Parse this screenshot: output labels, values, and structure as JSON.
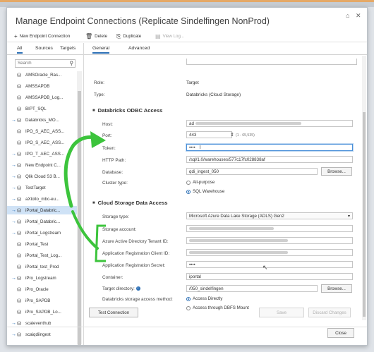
{
  "window": {
    "title": "Manage Endpoint Connections (Replicate Sindelfingen NonProd)",
    "restore_glyph": "⌂",
    "close_glyph": "✕"
  },
  "toolbar": {
    "new_label": "New Endpoint Connection",
    "delete_label": "Delete",
    "duplicate_label": "Duplicate",
    "view_logs_label": "View Log..."
  },
  "left": {
    "tabs": [
      "All",
      "Sources",
      "Targets"
    ],
    "search_placeholder": "Search",
    "items": [
      {
        "label": "AMSOracle_Ras...",
        "arrow": ""
      },
      {
        "label": "AMSSAPDB",
        "arrow": ""
      },
      {
        "label": "AMSSAPDB_Log...",
        "arrow": ""
      },
      {
        "label": "BIPT_SQL",
        "arrow": ""
      },
      {
        "label": "Databricks_MO...",
        "arrow": "→"
      },
      {
        "label": "IPO_S_AEC_ASS...",
        "arrow": ""
      },
      {
        "label": "IPO_S_AEC_ASS...",
        "arrow": ""
      },
      {
        "label": "IPO_T_AEC_ASS...",
        "arrow": "→"
      },
      {
        "label": "New Endpoint C...",
        "arrow": "→"
      },
      {
        "label": "Qlik Cloud S3 B...",
        "arrow": "→"
      },
      {
        "label": "TestTarget",
        "arrow": "→"
      },
      {
        "label": "aXtollo_mbc-eu...",
        "arrow": "→"
      },
      {
        "label": "iPortal_Databric...",
        "arrow": "→"
      },
      {
        "label": "iPortal_Databric...",
        "arrow": "→"
      },
      {
        "label": "iPortal_Logstream",
        "arrow": "→"
      },
      {
        "label": "iPortal_Test",
        "arrow": ""
      },
      {
        "label": "iPortal_Test_Log...",
        "arrow": ""
      },
      {
        "label": "iPortal_test_Prod",
        "arrow": ""
      },
      {
        "label": "iPro_Logstream",
        "arrow": "→"
      },
      {
        "label": "iPro_Oracle",
        "arrow": ""
      },
      {
        "label": "iPro_SAPDB",
        "arrow": ""
      },
      {
        "label": "iPro_SAPDB_Lo...",
        "arrow": ""
      },
      {
        "label": "scaieventhub",
        "arrow": "→"
      },
      {
        "label": "scaiqdiingest",
        "arrow": "→"
      }
    ],
    "selected_index": 12
  },
  "right": {
    "tabs": [
      "General",
      "Advanced"
    ],
    "role_label": "Role:",
    "role_value": "Target",
    "type_label": "Type:",
    "type_value": "Databricks (Cloud Storage)",
    "odbc_section": "Databricks ODBC Access",
    "host_label": "Host:",
    "host_value": "ad",
    "port_label": "Port:",
    "port_value": "443",
    "port_range": "(1 - 65,535)",
    "token_label": "Token:",
    "token_value": "••••",
    "http_label": "HTTP Path:",
    "http_value": "/sql/1.0/warehouses/577c17fc028838af",
    "database_label": "Database:",
    "database_value": "qdi_ingest_050",
    "browse_label": "Browse...",
    "cluster_label": "Cluster type:",
    "cluster_options": [
      "All-purpose",
      "SQL Warehouse"
    ],
    "cluster_selected": 1,
    "cloud_section": "Cloud Storage Data Access",
    "storage_type_label": "Storage type:",
    "storage_type_value": "Microsoft Azure Data Lake Storage (ADLS) Gen2",
    "storage_account_label": "Storage account:",
    "tenant_label": "Azure Active Directory Tenant ID:",
    "client_label": "Application Registration Client ID:",
    "secret_label": "Application Registration Secret:",
    "secret_value": "••••",
    "container_label": "Container:",
    "container_value": "iportal",
    "target_dir_label": "Target directory:",
    "target_dir_value": "/050_sindelfingen",
    "method_label": "Databricks storage access method:",
    "method_options": [
      "Access Directly",
      "Access through DBFS Mount"
    ],
    "method_selected": 0
  },
  "footer": {
    "test_label": "Test Connection",
    "save_label": "Save",
    "discard_label": "Discard Changes",
    "close_label": "Close"
  },
  "colors": {
    "accent": "#2a6eb5",
    "annotation_green": "#3cc43c",
    "selection": "#cfe2f6"
  }
}
